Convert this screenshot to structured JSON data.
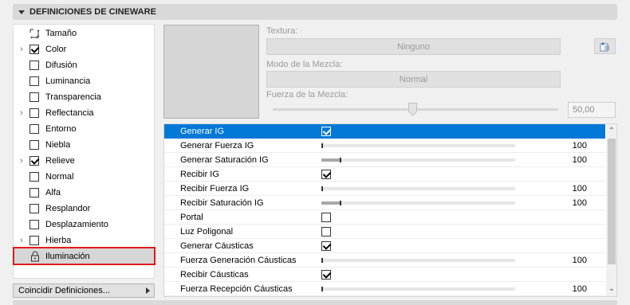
{
  "panel": {
    "title": "DEFINICIONES DE CINEWARE"
  },
  "sidebar": {
    "items": [
      {
        "label": "Tamaño",
        "icon": "resize-icon",
        "checked": null,
        "expandable": false
      },
      {
        "label": "Color",
        "checked": true,
        "expandable": true
      },
      {
        "label": "Difusión",
        "checked": false,
        "expandable": false
      },
      {
        "label": "Luminancia",
        "checked": false,
        "expandable": false
      },
      {
        "label": "Transparencia",
        "checked": false,
        "expandable": false
      },
      {
        "label": "Reflectancia",
        "checked": false,
        "expandable": true
      },
      {
        "label": "Entorno",
        "checked": false,
        "expandable": false
      },
      {
        "label": "Niebla",
        "checked": false,
        "expandable": false
      },
      {
        "label": "Relieve",
        "checked": true,
        "expandable": true
      },
      {
        "label": "Normal",
        "checked": false,
        "expandable": false
      },
      {
        "label": "Alfa",
        "checked": false,
        "expandable": false
      },
      {
        "label": "Resplandor",
        "checked": false,
        "expandable": false
      },
      {
        "label": "Desplazamiento",
        "checked": false,
        "expandable": false
      },
      {
        "label": "Hierba",
        "checked": false,
        "expandable": true
      },
      {
        "label": "Iluminación",
        "icon": "lock-icon",
        "checked": null,
        "expandable": false,
        "selected": true
      }
    ],
    "match_button_label": "Coincidir Definiciones..."
  },
  "texture": {
    "texture_label": "Textura:",
    "texture_value": "Ninguno",
    "blend_mode_label": "Modo de la Mezcla:",
    "blend_mode_value": "Normal",
    "blend_strength_label": "Fuerza de la Mezcla:",
    "blend_strength_value": "50,00",
    "blend_strength_fraction": 0.5
  },
  "properties": {
    "rows": [
      {
        "label": "Generar IG",
        "type": "checkbox",
        "checked": true,
        "highlight": true
      },
      {
        "label": "Generar Fuerza IG",
        "type": "slider",
        "fill": 0.0,
        "value": "100"
      },
      {
        "label": "Generar Saturación IG",
        "type": "slider",
        "fill": 0.1,
        "value": "100"
      },
      {
        "label": "Recibir IG",
        "type": "checkbox",
        "checked": true
      },
      {
        "label": "Recibir Fuerza IG",
        "type": "slider",
        "fill": 0.0,
        "value": "100"
      },
      {
        "label": "Recibir Saturación IG",
        "type": "slider",
        "fill": 0.1,
        "value": "100"
      },
      {
        "label": "Portal",
        "type": "checkbox",
        "checked": false
      },
      {
        "label": "Luz Poligonal",
        "type": "checkbox",
        "checked": false
      },
      {
        "label": "Generar Cáusticas",
        "type": "checkbox",
        "checked": true
      },
      {
        "label": "Fuerza Generación Cáusticas",
        "type": "slider",
        "fill": 0.0,
        "value": "100"
      },
      {
        "label": "Recibir Cáusticas",
        "type": "checkbox",
        "checked": true
      },
      {
        "label": "Fuerza Recepción Cáusticas",
        "type": "slider",
        "fill": 0.0,
        "value": "100"
      }
    ]
  },
  "colors": {
    "selection": "#0078d7",
    "highlight_outline": "#e21a1a"
  }
}
